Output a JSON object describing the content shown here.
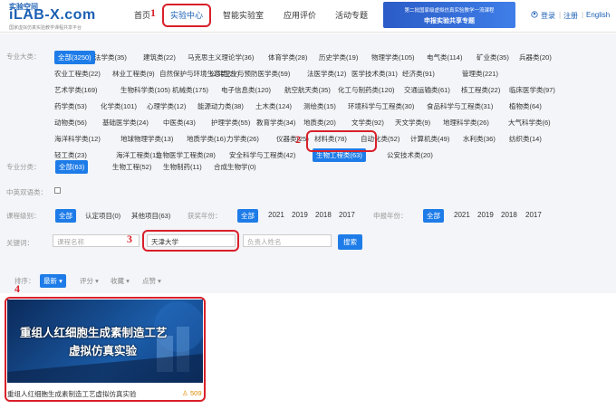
{
  "logo": {
    "top": "实验空间",
    "main": "iLAB-X.com",
    "sub": "国家虚拟仿真实验教学课程共享平台"
  },
  "nav": [
    "首页",
    "实验中心",
    "智能实验室",
    "应用评价",
    "活动专题"
  ],
  "banner": {
    "line1": "第二批国家级虚拟仿真实验教学一流课程",
    "line2": "申报实验共享专题"
  },
  "header_right": {
    "login": "登录",
    "register": "注册",
    "lang": "English"
  },
  "annotations": [
    "1",
    "2",
    "3",
    "4"
  ],
  "filter": {
    "major_label": "专业大类：",
    "majors": [
      [
        "全部(3250)",
        "法学类(35)",
        "建筑类(22)",
        "马克思主义理论学(36)",
        "体育学类(28)",
        "历史学类(19)",
        "物理学类(105)",
        "电气类(114)",
        "矿业类(35)",
        "兵器类(20)"
      ],
      [
        "农业工程类(22)",
        "林业工程类(9)",
        "自然保护与环境生态类(27)",
        "公共卫生与预防医学类(59)",
        "法医学类(12)",
        "医学技术类(31)",
        "经济类(91)",
        "管理类(221)"
      ],
      [
        "艺术学类(169)",
        "生物科学类(105)",
        "机械类(175)",
        "电子信息类(120)",
        "航空航天类(35)",
        "化工与制药类(120)",
        "交通运输类(61)",
        "核工程类(22)",
        "临床医学类(97)"
      ],
      [
        "药学类(53)",
        "化学类(101)",
        "心理学类(12)",
        "能源动力类(38)",
        "土木类(124)",
        "测绘类(15)",
        "环境科学与工程类(30)",
        "食品科学与工程类(31)",
        "植物类(64)"
      ],
      [
        "动物类(56)",
        "基础医学类(24)",
        "中医类(43)",
        "护理学类(55)",
        "教育学类(34)",
        "地质类(20)",
        "文学类(92)",
        "天文学类(9)",
        "地理科学类(26)",
        "大气科学类(6)"
      ],
      [
        "海洋科学类(12)",
        "地球物理学类(13)",
        "地质学类(16)",
        "力学类(26)",
        "仪器类(25)",
        "材料类(78)",
        "自动化类(52)",
        "计算机类(49)",
        "水利类(36)",
        "纺织类(14)"
      ],
      [
        "轻工类(23)",
        "海洋工程类(11)",
        "生物医学工程类(28)",
        "安全科学与工程类(42)",
        "生物工程类(63)",
        "公安技术类(20)"
      ]
    ],
    "sub_label": "专业分类：",
    "subs": [
      "全部(63)",
      "生物工程(52)",
      "生物制药(11)",
      "合成生物学(0)"
    ],
    "bilingual_label": "中英双语类：",
    "level_label": "课程级别：",
    "levels": [
      "全部",
      "认定项目(0)",
      "其他项目(63)"
    ],
    "award_label": "获奖年份：",
    "award_years": [
      "全部",
      "2021",
      "2019",
      "2018",
      "2017"
    ],
    "apply_label": "申报年份：",
    "apply_years": [
      "全部",
      "2021",
      "2019",
      "2018",
      "2017"
    ],
    "keyword_label": "关键词：",
    "course_placeholder": "课程名称",
    "school_value": "天津大学",
    "person_placeholder": "负责人姓名",
    "search_label": "搜索"
  },
  "sort": {
    "label": "排序：",
    "options": [
      "最新",
      "评分",
      "收藏",
      "点赞"
    ]
  },
  "card": {
    "banner_line1": "重组人红细胞生成素制造工艺",
    "banner_line2": "虚拟仿真实验",
    "title": "重组人红细胞生成素制造工艺虚拟仿真实验",
    "count": "509"
  },
  "colors": {
    "accent": "#1e7ce8",
    "brand": "#1a5fb4",
    "annotation": "#d9202a"
  }
}
